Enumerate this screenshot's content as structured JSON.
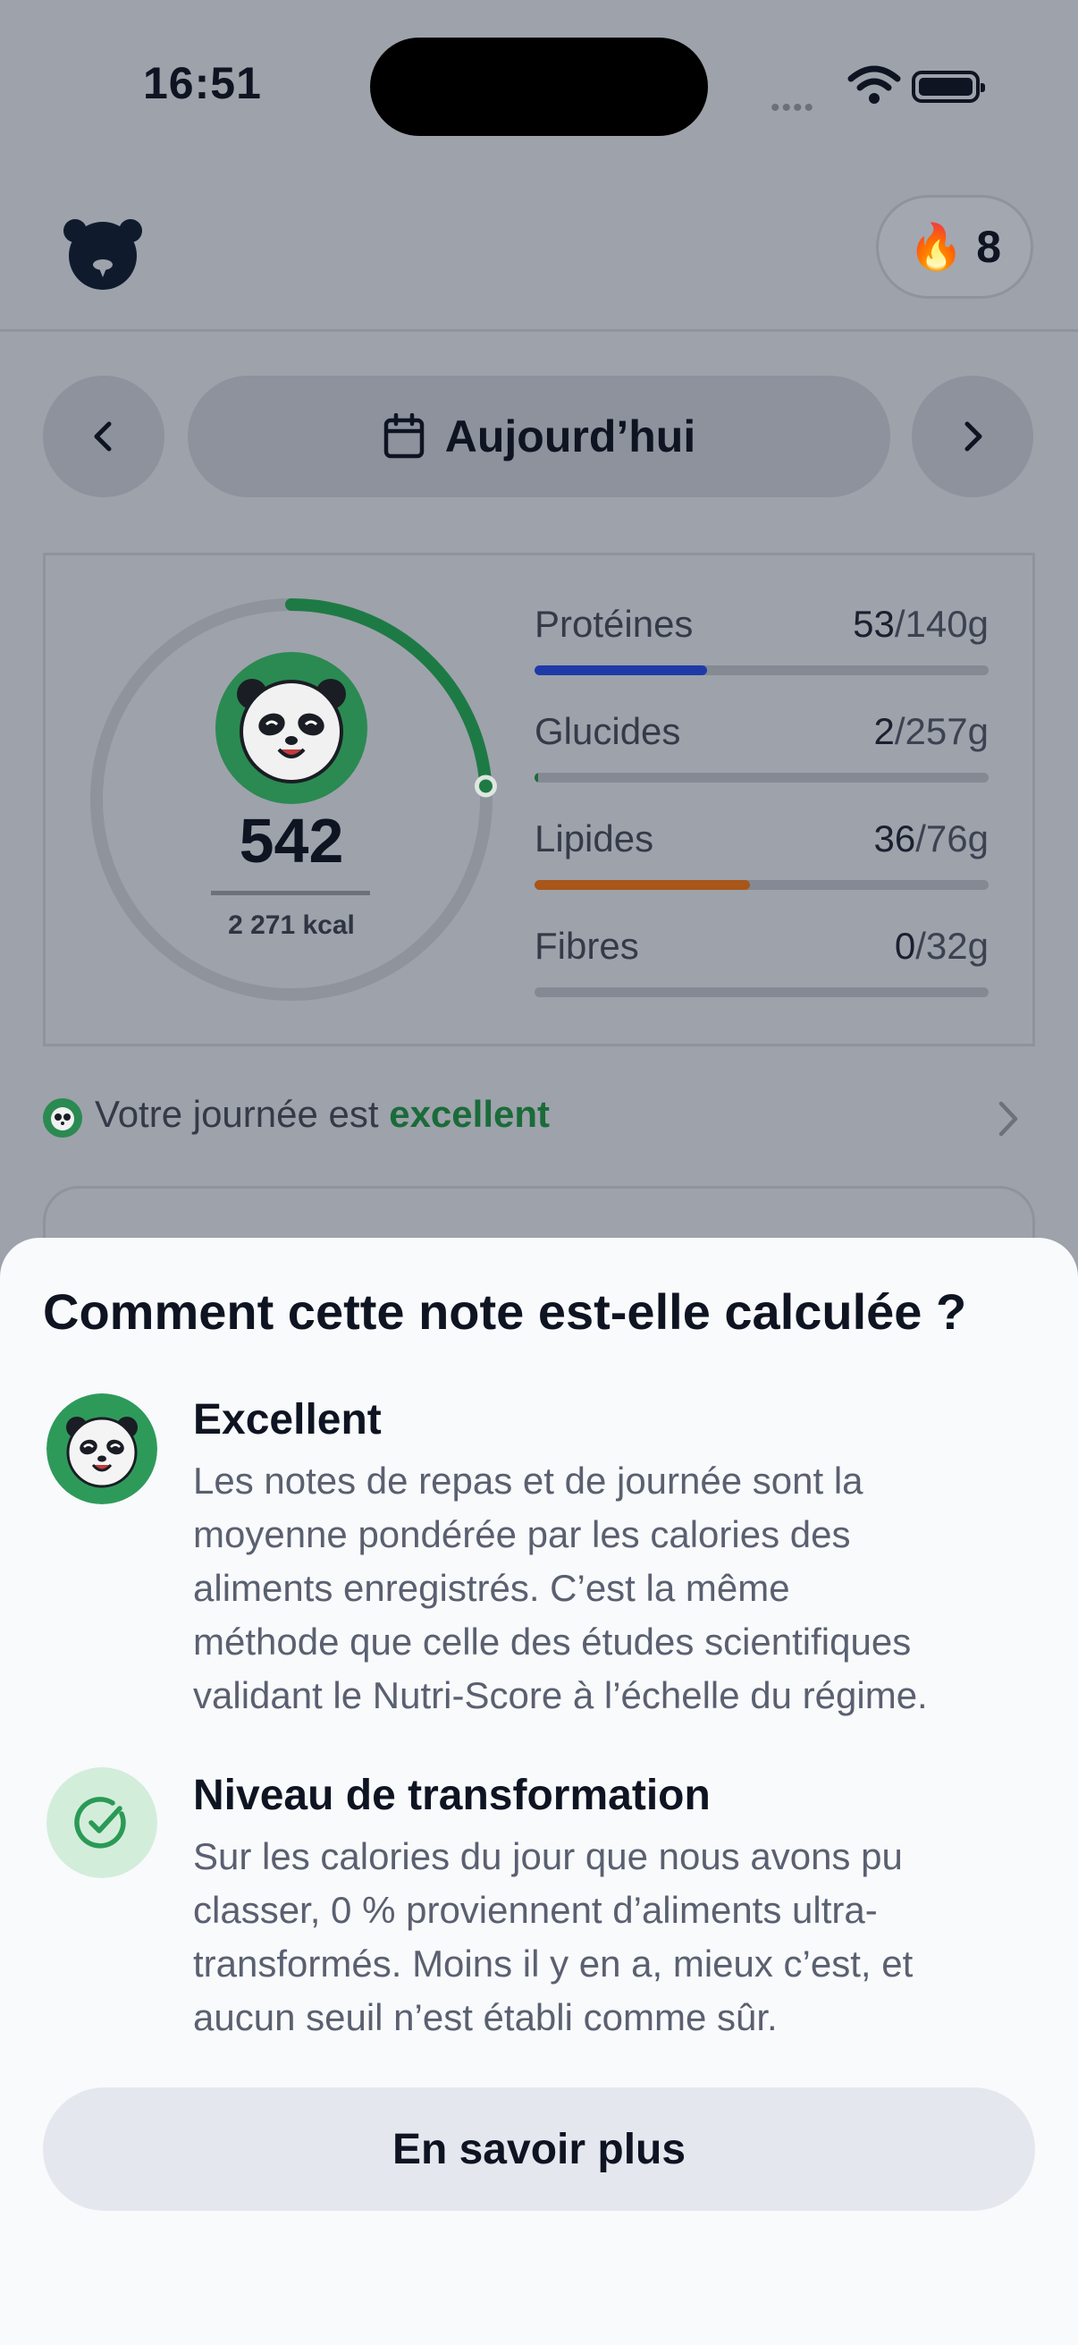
{
  "status_bar": {
    "time": "16:51",
    "signal_dots": "••••"
  },
  "header": {
    "logo_icon": "bear-face-icon",
    "streak_icon": "fire-icon",
    "streak_count": "8"
  },
  "date_nav": {
    "prev_icon": "chevron-left-icon",
    "next_icon": "chevron-right-icon",
    "calendar_icon": "calendar-icon",
    "label": "Aujourd’hui"
  },
  "summary": {
    "calories_eaten": "542",
    "calorie_goal": "2 271 kcal",
    "calorie_progress": 0.239,
    "macros": [
      {
        "name": "Protéines",
        "value": "53",
        "target": "/140g",
        "progress": 0.379,
        "color": "#1f3aa8"
      },
      {
        "name": "Glucides",
        "value": "2",
        "target": "/257g",
        "progress": 0.008,
        "color": "#1a6b3a"
      },
      {
        "name": "Lipides",
        "value": "36",
        "target": "/76g",
        "progress": 0.474,
        "color": "#a8561a"
      },
      {
        "name": "Fibres",
        "value": "0",
        "target": "/32g",
        "progress": 0.0,
        "color": "#1a6b3a"
      }
    ]
  },
  "day_rating": {
    "prefix": "Votre journée est ",
    "value": "excellent",
    "chevron_icon": "chevron-right-icon"
  },
  "sheet": {
    "title": "Comment cette note est-elle calculée ?",
    "items": [
      {
        "icon": "panda-face-icon",
        "heading": "Excellent",
        "lines": [
          "Les notes de repas et de journée sont la",
          "moyenne pondérée par les calories des",
          "aliments enregistrés. C’est la même",
          "méthode que celle des études scientifiques",
          "validant le Nutri-Score à l’échelle du régime."
        ]
      },
      {
        "icon": "check-circle-icon",
        "heading": "Niveau de transformation",
        "lines": [
          "Sur les calories du jour que nous avons pu",
          "classer, 0 % proviennent d’aliments ultra-",
          "transformés. Moins il y en a, mieux c’est, et",
          "aucun seuil n’est établi comme sûr."
        ]
      }
    ],
    "button_label": "En savoir plus"
  },
  "colors": {
    "accent_green": "#2e8b57",
    "dark_green": "#1a6b3a",
    "sheet_bg": "#f8fafc",
    "overlay_bg": "#9ea2ab"
  }
}
